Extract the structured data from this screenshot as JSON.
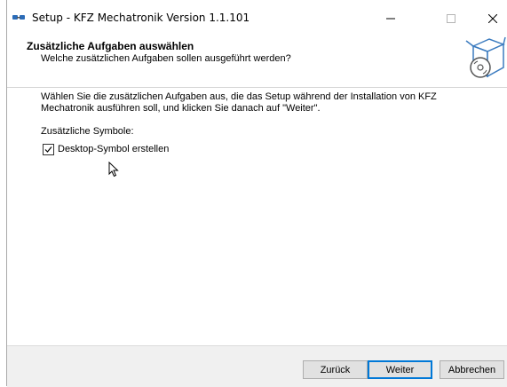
{
  "window": {
    "title": "Setup - KFZ Mechatronik Version 1.1.101"
  },
  "header": {
    "title": "Zusätzliche Aufgaben auswählen",
    "subtitle": "Welche zusätzlichen Aufgaben sollen ausgeführt werden?"
  },
  "content": {
    "description": "Wählen Sie die zusätzlichen Aufgaben aus, die das Setup während der Installation von KFZ Mechatronik ausführen soll, und klicken Sie danach auf \"Weiter\".",
    "group_label": "Zusätzliche Symbole:",
    "tasks": [
      {
        "label": "Desktop-Symbol erstellen",
        "checked": true
      }
    ]
  },
  "footer": {
    "back_label": "Zurück",
    "next_label": "Weiter",
    "cancel_label": "Abbrechen"
  },
  "icons": {
    "app": "setup-app-icon",
    "wizard": "cd-box-install-icon",
    "minimize": "minimize-icon",
    "maximize": "maximize-icon",
    "close": "close-icon",
    "cursor": "mouse-pointer-icon"
  },
  "colors": {
    "accent": "#0078d7",
    "window_bg": "#f0f0f0",
    "panel_bg": "#ffffff"
  }
}
